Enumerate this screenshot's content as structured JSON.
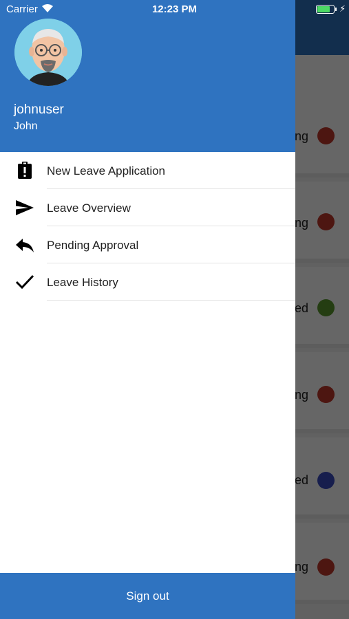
{
  "status_bar": {
    "carrier": "Carrier",
    "time": "12:23 PM",
    "battery_level": 0.85,
    "battery_color": "#4cd964"
  },
  "drawer": {
    "username": "johnuser",
    "display_name": "John",
    "menu_items": [
      {
        "label": "New Leave Application",
        "icon": "clipboard-alert-icon"
      },
      {
        "label": "Leave Overview",
        "icon": "send-icon"
      },
      {
        "label": "Pending Approval",
        "icon": "reply-icon"
      },
      {
        "label": "Leave History",
        "icon": "check-icon"
      }
    ],
    "signout_label": "Sign out"
  },
  "background_list": {
    "items": [
      {
        "text_fragment": "ng",
        "dot_color": "#c0392b"
      },
      {
        "text_fragment": "ng",
        "dot_color": "#c0392b"
      },
      {
        "text_fragment": "ed",
        "dot_color": "#5a9a2f"
      },
      {
        "text_fragment": "ng",
        "dot_color": "#c0392b"
      },
      {
        "text_fragment": "ed",
        "dot_color": "#3a4bc0"
      },
      {
        "text_fragment": "ng",
        "dot_color": "#c0392b"
      }
    ]
  },
  "colors": {
    "primary": "#2f73c0"
  }
}
